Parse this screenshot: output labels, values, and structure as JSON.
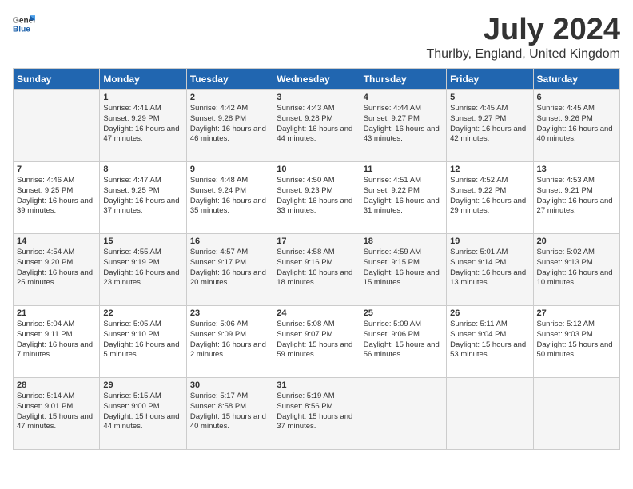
{
  "header": {
    "logo_general": "General",
    "logo_blue": "Blue",
    "title": "July 2024",
    "subtitle": "Thurlby, England, United Kingdom"
  },
  "days_of_week": [
    "Sunday",
    "Monday",
    "Tuesday",
    "Wednesday",
    "Thursday",
    "Friday",
    "Saturday"
  ],
  "weeks": [
    [
      {
        "day": "",
        "sunrise": "",
        "sunset": "",
        "daylight": ""
      },
      {
        "day": "1",
        "sunrise": "Sunrise: 4:41 AM",
        "sunset": "Sunset: 9:29 PM",
        "daylight": "Daylight: 16 hours and 47 minutes."
      },
      {
        "day": "2",
        "sunrise": "Sunrise: 4:42 AM",
        "sunset": "Sunset: 9:28 PM",
        "daylight": "Daylight: 16 hours and 46 minutes."
      },
      {
        "day": "3",
        "sunrise": "Sunrise: 4:43 AM",
        "sunset": "Sunset: 9:28 PM",
        "daylight": "Daylight: 16 hours and 44 minutes."
      },
      {
        "day": "4",
        "sunrise": "Sunrise: 4:44 AM",
        "sunset": "Sunset: 9:27 PM",
        "daylight": "Daylight: 16 hours and 43 minutes."
      },
      {
        "day": "5",
        "sunrise": "Sunrise: 4:45 AM",
        "sunset": "Sunset: 9:27 PM",
        "daylight": "Daylight: 16 hours and 42 minutes."
      },
      {
        "day": "6",
        "sunrise": "Sunrise: 4:45 AM",
        "sunset": "Sunset: 9:26 PM",
        "daylight": "Daylight: 16 hours and 40 minutes."
      }
    ],
    [
      {
        "day": "7",
        "sunrise": "Sunrise: 4:46 AM",
        "sunset": "Sunset: 9:25 PM",
        "daylight": "Daylight: 16 hours and 39 minutes."
      },
      {
        "day": "8",
        "sunrise": "Sunrise: 4:47 AM",
        "sunset": "Sunset: 9:25 PM",
        "daylight": "Daylight: 16 hours and 37 minutes."
      },
      {
        "day": "9",
        "sunrise": "Sunrise: 4:48 AM",
        "sunset": "Sunset: 9:24 PM",
        "daylight": "Daylight: 16 hours and 35 minutes."
      },
      {
        "day": "10",
        "sunrise": "Sunrise: 4:50 AM",
        "sunset": "Sunset: 9:23 PM",
        "daylight": "Daylight: 16 hours and 33 minutes."
      },
      {
        "day": "11",
        "sunrise": "Sunrise: 4:51 AM",
        "sunset": "Sunset: 9:22 PM",
        "daylight": "Daylight: 16 hours and 31 minutes."
      },
      {
        "day": "12",
        "sunrise": "Sunrise: 4:52 AM",
        "sunset": "Sunset: 9:22 PM",
        "daylight": "Daylight: 16 hours and 29 minutes."
      },
      {
        "day": "13",
        "sunrise": "Sunrise: 4:53 AM",
        "sunset": "Sunset: 9:21 PM",
        "daylight": "Daylight: 16 hours and 27 minutes."
      }
    ],
    [
      {
        "day": "14",
        "sunrise": "Sunrise: 4:54 AM",
        "sunset": "Sunset: 9:20 PM",
        "daylight": "Daylight: 16 hours and 25 minutes."
      },
      {
        "day": "15",
        "sunrise": "Sunrise: 4:55 AM",
        "sunset": "Sunset: 9:19 PM",
        "daylight": "Daylight: 16 hours and 23 minutes."
      },
      {
        "day": "16",
        "sunrise": "Sunrise: 4:57 AM",
        "sunset": "Sunset: 9:17 PM",
        "daylight": "Daylight: 16 hours and 20 minutes."
      },
      {
        "day": "17",
        "sunrise": "Sunrise: 4:58 AM",
        "sunset": "Sunset: 9:16 PM",
        "daylight": "Daylight: 16 hours and 18 minutes."
      },
      {
        "day": "18",
        "sunrise": "Sunrise: 4:59 AM",
        "sunset": "Sunset: 9:15 PM",
        "daylight": "Daylight: 16 hours and 15 minutes."
      },
      {
        "day": "19",
        "sunrise": "Sunrise: 5:01 AM",
        "sunset": "Sunset: 9:14 PM",
        "daylight": "Daylight: 16 hours and 13 minutes."
      },
      {
        "day": "20",
        "sunrise": "Sunrise: 5:02 AM",
        "sunset": "Sunset: 9:13 PM",
        "daylight": "Daylight: 16 hours and 10 minutes."
      }
    ],
    [
      {
        "day": "21",
        "sunrise": "Sunrise: 5:04 AM",
        "sunset": "Sunset: 9:11 PM",
        "daylight": "Daylight: 16 hours and 7 minutes."
      },
      {
        "day": "22",
        "sunrise": "Sunrise: 5:05 AM",
        "sunset": "Sunset: 9:10 PM",
        "daylight": "Daylight: 16 hours and 5 minutes."
      },
      {
        "day": "23",
        "sunrise": "Sunrise: 5:06 AM",
        "sunset": "Sunset: 9:09 PM",
        "daylight": "Daylight: 16 hours and 2 minutes."
      },
      {
        "day": "24",
        "sunrise": "Sunrise: 5:08 AM",
        "sunset": "Sunset: 9:07 PM",
        "daylight": "Daylight: 15 hours and 59 minutes."
      },
      {
        "day": "25",
        "sunrise": "Sunrise: 5:09 AM",
        "sunset": "Sunset: 9:06 PM",
        "daylight": "Daylight: 15 hours and 56 minutes."
      },
      {
        "day": "26",
        "sunrise": "Sunrise: 5:11 AM",
        "sunset": "Sunset: 9:04 PM",
        "daylight": "Daylight: 15 hours and 53 minutes."
      },
      {
        "day": "27",
        "sunrise": "Sunrise: 5:12 AM",
        "sunset": "Sunset: 9:03 PM",
        "daylight": "Daylight: 15 hours and 50 minutes."
      }
    ],
    [
      {
        "day": "28",
        "sunrise": "Sunrise: 5:14 AM",
        "sunset": "Sunset: 9:01 PM",
        "daylight": "Daylight: 15 hours and 47 minutes."
      },
      {
        "day": "29",
        "sunrise": "Sunrise: 5:15 AM",
        "sunset": "Sunset: 9:00 PM",
        "daylight": "Daylight: 15 hours and 44 minutes."
      },
      {
        "day": "30",
        "sunrise": "Sunrise: 5:17 AM",
        "sunset": "Sunset: 8:58 PM",
        "daylight": "Daylight: 15 hours and 40 minutes."
      },
      {
        "day": "31",
        "sunrise": "Sunrise: 5:19 AM",
        "sunset": "Sunset: 8:56 PM",
        "daylight": "Daylight: 15 hours and 37 minutes."
      },
      {
        "day": "",
        "sunrise": "",
        "sunset": "",
        "daylight": ""
      },
      {
        "day": "",
        "sunrise": "",
        "sunset": "",
        "daylight": ""
      },
      {
        "day": "",
        "sunrise": "",
        "sunset": "",
        "daylight": ""
      }
    ]
  ]
}
